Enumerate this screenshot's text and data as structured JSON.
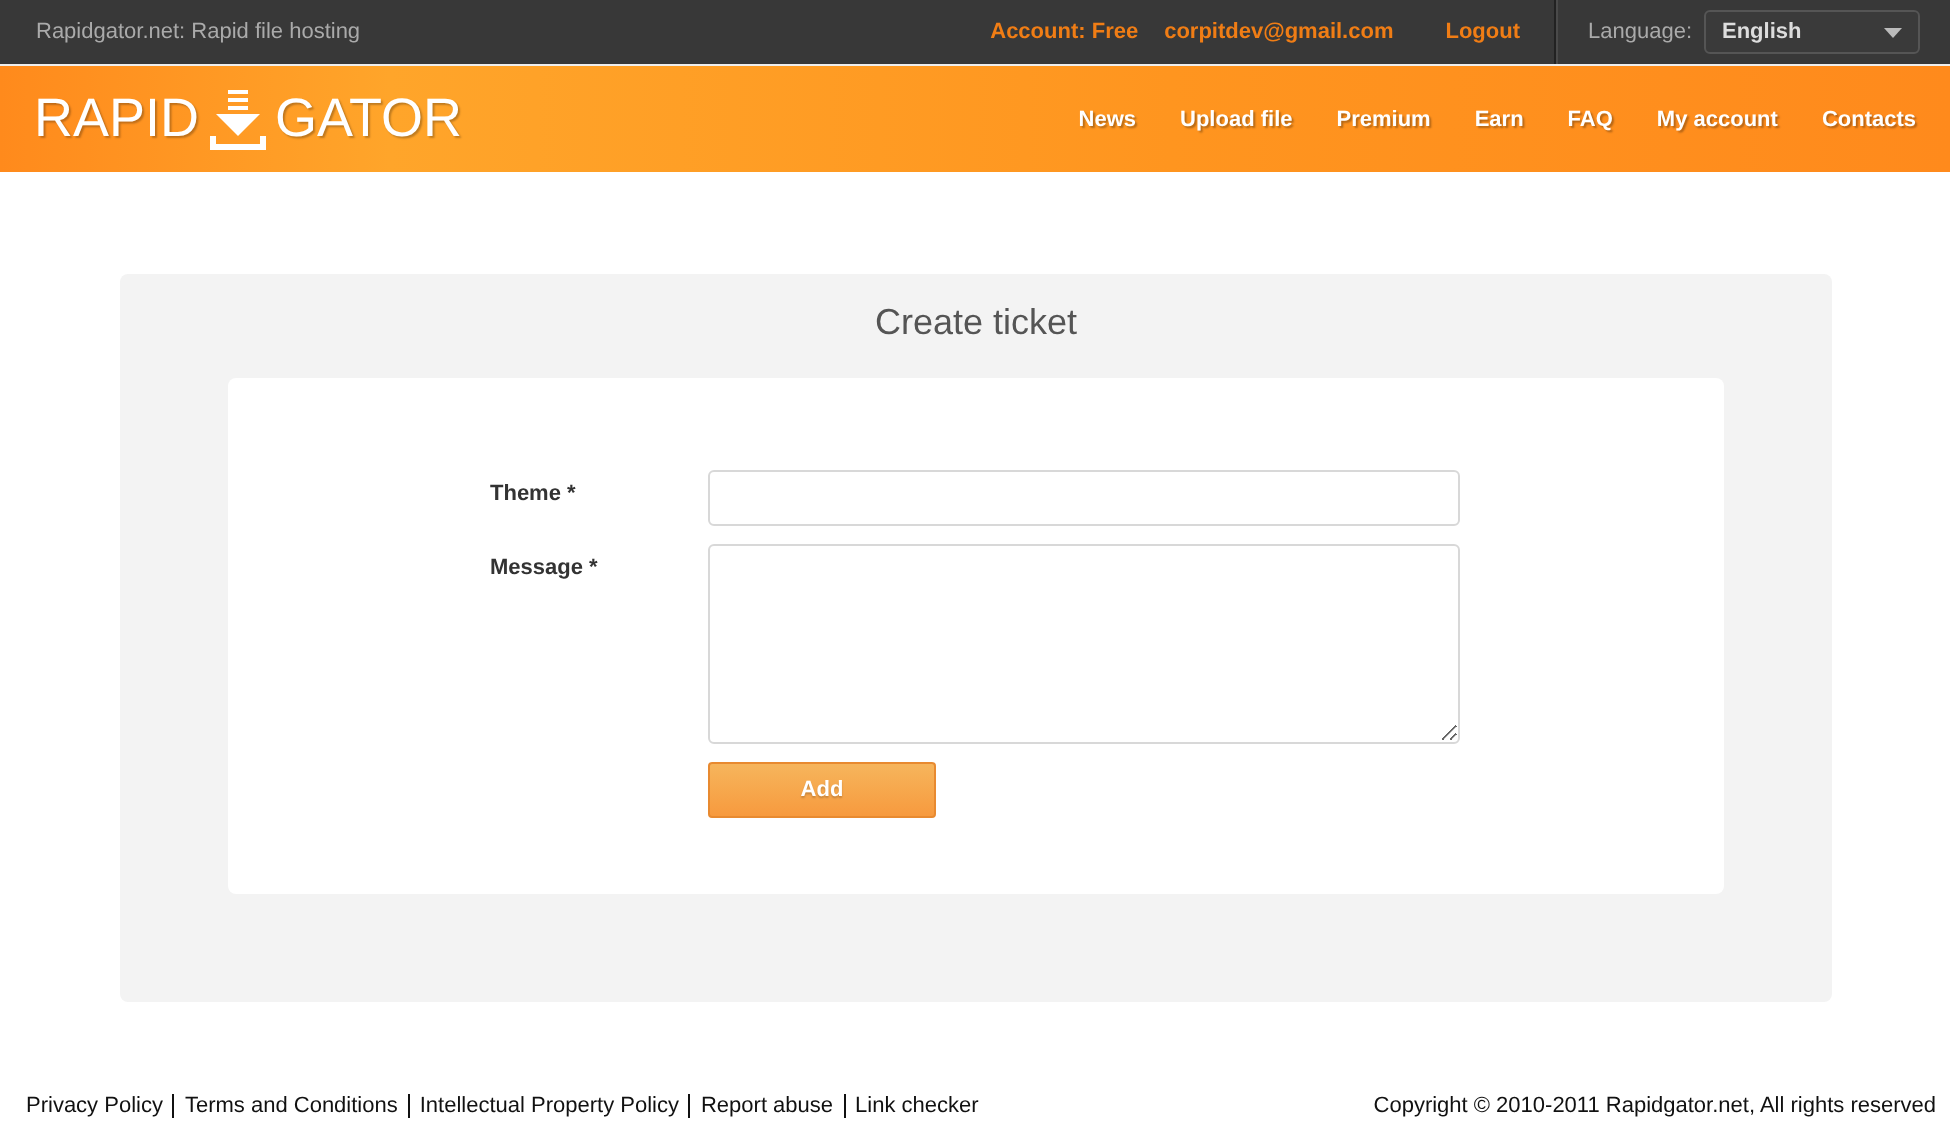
{
  "topbar": {
    "site_title": "Rapidgator.net: Rapid file hosting",
    "account": "Account: Free",
    "email": "corpitdev@gmail.com",
    "logout": "Logout",
    "language_label": "Language:",
    "language": "English"
  },
  "logo": {
    "left": "RAPID",
    "right": "GATOR"
  },
  "nav": [
    "News",
    "Upload file",
    "Premium",
    "Earn",
    "FAQ",
    "My account",
    "Contacts"
  ],
  "form": {
    "title": "Create ticket",
    "fields": [
      {
        "label": "Theme *",
        "kind": "input"
      },
      {
        "label": "Message *",
        "kind": "textarea"
      }
    ],
    "submit": "Add"
  },
  "footer": {
    "links": [
      "Privacy Policy",
      "Terms and Conditions",
      "Intellectual Property Policy",
      "Report abuse",
      "Link checker"
    ],
    "copyright": "Copyright © 2010-2011 Rapidgator.net, All rights reserved"
  }
}
